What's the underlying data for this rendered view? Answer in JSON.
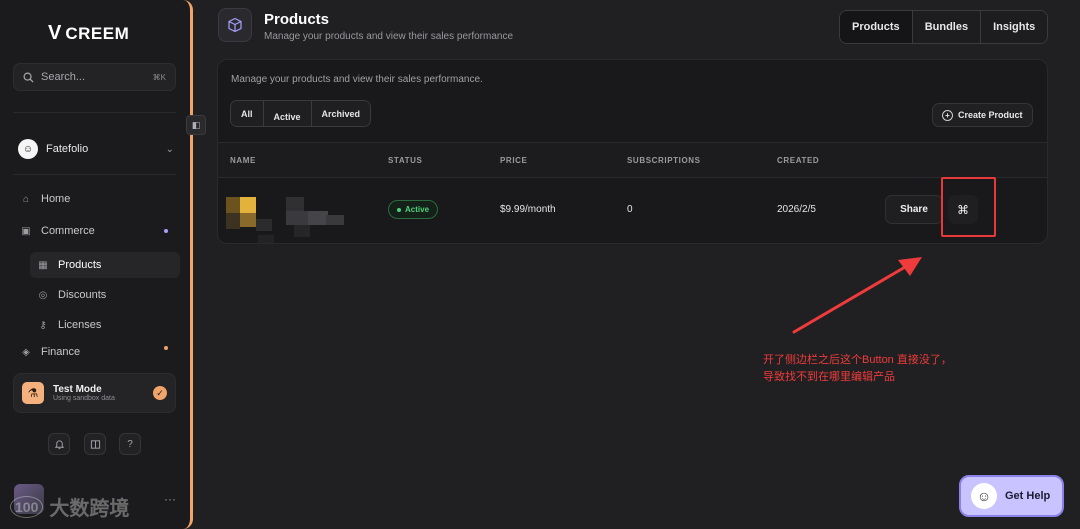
{
  "sidebar": {
    "logo_mark": "V",
    "logo_text": "CREEM",
    "search_placeholder": "Search...",
    "search_shortcut": "⌘K",
    "org_name": "Fatefolio",
    "nav": [
      {
        "label": "Home",
        "icon": "home-icon",
        "glyph": "⌂"
      },
      {
        "label": "Commerce",
        "icon": "commerce-icon",
        "glyph": "▣"
      },
      {
        "label": "Products",
        "icon": "image-icon",
        "glyph": "▦"
      },
      {
        "label": "Discounts",
        "icon": "discount-icon",
        "glyph": "◎"
      },
      {
        "label": "Licenses",
        "icon": "key-icon",
        "glyph": "⚷"
      },
      {
        "label": "Finance",
        "icon": "finance-icon",
        "glyph": "◈"
      }
    ],
    "test_mode": {
      "title": "Test Mode",
      "subtitle": "Using sandbox data"
    },
    "footer_icons": [
      "bell-icon",
      "book-icon",
      "help-icon"
    ]
  },
  "header": {
    "title": "Products",
    "subtitle": "Manage your products and view their sales performance",
    "tabs": [
      "Products",
      "Bundles",
      "Insights"
    ]
  },
  "card": {
    "subtitle": "Manage your products and view their sales performance.",
    "filters": [
      "All",
      "Active",
      "Archived"
    ],
    "create_label": "Create Product",
    "columns": [
      "NAME",
      "STATUS",
      "PRICE",
      "SUBSCRIPTIONS",
      "CREATED"
    ],
    "rows": [
      {
        "status": "Active",
        "price": "$9.99/month",
        "subscriptions": "0",
        "created": "2026/2/5",
        "share": "Share",
        "more": "⌘"
      }
    ]
  },
  "annotation": {
    "line1": "开了侧边栏之后这个Button 直接没了，",
    "line2": "导致找不到在哪里编辑产品"
  },
  "help": {
    "label": "Get Help"
  },
  "watermark": "大数跨境",
  "colors": {
    "accent": "#f0a36a",
    "brand": "#a7a0ff",
    "annotation": "#ef3b3b",
    "success": "#4ed07c"
  }
}
